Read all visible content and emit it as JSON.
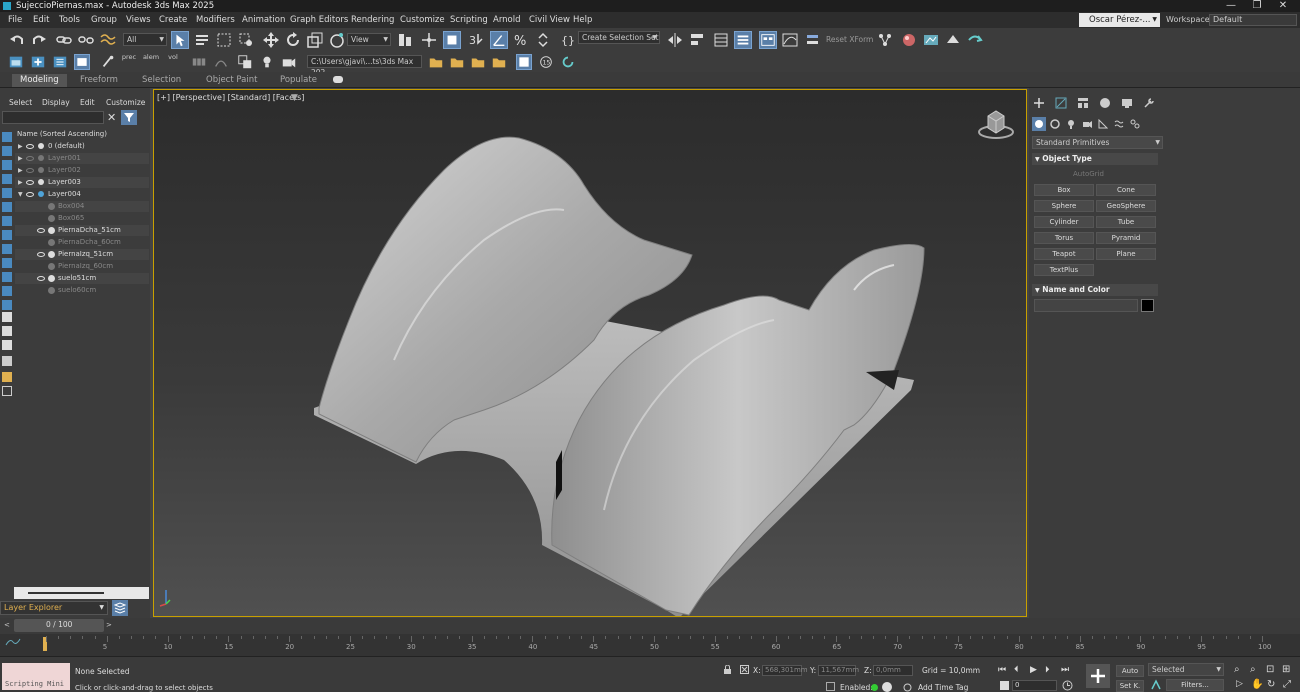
{
  "window": {
    "title": "SujeccioPiernas.max - Autodesk 3ds Max 2025",
    "minimize": "—",
    "maximize": "❐",
    "close": "✕"
  },
  "menu": [
    "File",
    "Edit",
    "Tools",
    "Group",
    "Views",
    "Create",
    "Modifiers",
    "Animation",
    "Graph Editors",
    "Rendering",
    "Customize",
    "Scripting",
    "Arnold",
    "Civil View",
    "Help"
  ],
  "user": {
    "name": "Oscar Pérez-...",
    "workspaces_label": "Workspaces:",
    "workspace": "Default"
  },
  "toolbar": {
    "selection_filter": "All",
    "reference_coord": "View",
    "selection_set": "Create Selection Set",
    "reset_xform": "Reset XForm",
    "path": "C:\\Users\\gjavi\\...ts\\3ds Max 202",
    "layer_labels": [
      "prec",
      "alem",
      "vol",
      "prec",
      "alem",
      "vol"
    ]
  },
  "ribbon": {
    "tabs": [
      "Modeling",
      "Freeform",
      "Selection",
      "Object Paint",
      "Populate"
    ],
    "active": "Modeling"
  },
  "explorer": {
    "tabs": [
      "Select",
      "Display",
      "Edit",
      "Customize"
    ],
    "header": "Name (Sorted Ascending)",
    "rows": [
      {
        "name": "0 (default)",
        "level": 0,
        "dim": false
      },
      {
        "name": "Layer001",
        "level": 0,
        "dim": true
      },
      {
        "name": "Layer002",
        "level": 0,
        "dim": true
      },
      {
        "name": "Layer003",
        "level": 0,
        "dim": false
      },
      {
        "name": "Layer004",
        "level": 0,
        "dim": false
      },
      {
        "name": "Box004",
        "level": 1,
        "dim": true
      },
      {
        "name": "Box065",
        "level": 1,
        "dim": true
      },
      {
        "name": "PiernaDcha_51cm",
        "level": 1,
        "dim": false
      },
      {
        "name": "PiernaDcha_60cm",
        "level": 1,
        "dim": true
      },
      {
        "name": "PiernaIzq_51cm",
        "level": 1,
        "dim": false
      },
      {
        "name": "PiernaIzq_60cm",
        "level": 1,
        "dim": true
      },
      {
        "name": "suelo51cm",
        "level": 1,
        "dim": false
      },
      {
        "name": "suelo60cm",
        "level": 1,
        "dim": true
      }
    ],
    "footer": "Layer Explorer"
  },
  "viewport": {
    "label": "[+] [Perspective] [Standard] [Facets]"
  },
  "command_panel": {
    "category": "Standard Primitives",
    "object_type_title": "Object Type",
    "autogrid": "AutoGrid",
    "buttons": [
      "Box",
      "Cone",
      "Sphere",
      "GeoSphere",
      "Cylinder",
      "Tube",
      "Torus",
      "Pyramid",
      "Teapot",
      "Plane",
      "TextPlus"
    ],
    "name_color_title": "Name and Color"
  },
  "timeline": {
    "frame": "0 / 100",
    "ticks": [
      0,
      5,
      10,
      15,
      20,
      25,
      30,
      35,
      40,
      45,
      50,
      55,
      60,
      65,
      70,
      75,
      80,
      85,
      90,
      95,
      100
    ]
  },
  "status": {
    "script_label": "Scripting Mini",
    "selection": "None Selected",
    "prompt": "Click or click-and-drag to select objects",
    "x_label": "X:",
    "x": "568,301mm",
    "y_label": "Y:",
    "y": "11,567mm",
    "z_label": "Z:",
    "z": "0,0mm",
    "grid": "Grid = 10,0mm",
    "enabled": "Enabled:",
    "add_time_tag": "Add Time Tag",
    "auto": "Auto",
    "setk": "Set K.",
    "selected": "Selected",
    "filters": "Filters...",
    "frame_field": "0"
  },
  "colors": {
    "accent": "#5a7fa8",
    "viewport_border": "#c8a000",
    "mesh": "#b8b8b8"
  }
}
